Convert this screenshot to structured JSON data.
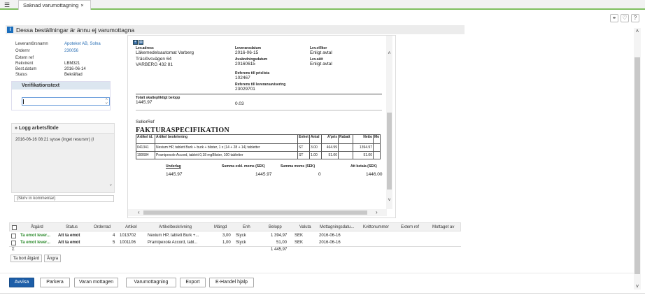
{
  "tab": {
    "title": "Saknad varumottagning",
    "close": "×"
  },
  "notice": "Dessa beställningar är ännu ej varumottagna",
  "info_fields": [
    {
      "label": "Leverantörsnamn",
      "value": "Apoteket AB, Solna",
      "link": true
    },
    {
      "label": "Ordernr",
      "value": "230056",
      "link": true
    },
    {
      "label": "Extern ref",
      "value": ""
    },
    {
      "label": "Rekvirent",
      "value": "LBM321"
    },
    {
      "label": "Best.datum",
      "value": "2016-06-14"
    },
    {
      "label": "Status",
      "value": "Bekräftad"
    }
  ],
  "verification": {
    "title": "Verifikationstext",
    "value": ""
  },
  "log": {
    "title": "Logg arbetsflöde",
    "entry": "2016-06-16 08:21 sysse  (inget resursnr) (I"
  },
  "comment_placeholder": "(Skriv in kommentar)",
  "doc": {
    "lev_adress_label": "Lev.adress",
    "lev_adress": [
      "Läkemedelsautomat Varberg",
      "Träslövsvägen 64",
      "VARBERG 432 81"
    ],
    "leveransdatum_label": "Leveransdatum",
    "leveransdatum": "2016-06-15",
    "avsandningsdatum_label": "Avsändningsdatum",
    "avsandningsdatum": "20160615",
    "ref_prislista_label": "Referens till prislista",
    "ref_prislista": "102467",
    "ref_leveransavisering_label": "Referens till leveransavisering",
    "ref_leveransavisering": "23029701",
    "levvillkor_label": "Lev.villkor",
    "levvillkor": "Enligt avtal",
    "levsatt_label": "Lev.sätt",
    "levsatt": "Enligt avtal",
    "totalt_label": "Totalt skattepliktigt belopp",
    "totalt": "1445.97",
    "moms_value": "0.03",
    "sellerref": "SellerRef",
    "fakt_title": "FAKTURASPECIFIKATION",
    "table_headers": [
      "Artikel id.",
      "Artikel beskrivning",
      "Enhet",
      "Antal",
      "A'pris",
      "Rabatt",
      "Netto",
      "Mo"
    ],
    "table_rows": [
      [
        "041341",
        "Nexium HP, tablett Burk + burk + blister, 1 x (14 + 28 + 14) tabletter",
        "ST",
        "3.00",
        "464.99",
        "",
        "1394.97",
        ""
      ],
      [
        "190684",
        "Pramipexole Accord, tablett 0,18 mgBlister, 100 tabletter",
        "ST",
        "1.00",
        "51.00",
        "",
        "51.00",
        ""
      ]
    ],
    "summary_labels": [
      "Underlag",
      "Summa exkl. moms (SEK)",
      "Summa moms (SEK)",
      "Att betala (SEK)"
    ],
    "summary_values": [
      "1445.97",
      "1445.97",
      "0",
      "1446.00"
    ]
  },
  "grid": {
    "headers": [
      "Åtgärd",
      "Status",
      "Orderrad",
      "Artikel",
      "Artikelbeskrivning",
      "Mängd",
      "Enh",
      "Belopp",
      "Valuta",
      "Mottagningsdatu...",
      "Kvittonummer",
      "Extern ref",
      "Mottaget av"
    ],
    "rows": [
      {
        "atgard": "Ta emot lever...",
        "status": "Att ta emot",
        "orderrad": "4",
        "artikel": "1013702",
        "beskrivning": "Nexium HP, tablett Burk +...",
        "mangd": "3,00",
        "enh": "Styck",
        "belopp": "1 394,97",
        "valuta": "SEK",
        "datum": "2016-06-16"
      },
      {
        "atgard": "Ta emot lever...",
        "status": "Att ta emot",
        "orderrad": "5",
        "artikel": "1001106",
        "beskrivning": "Pramipexole Accord, tabl...",
        "mangd": "1,00",
        "enh": "Styck",
        "belopp": "51,00",
        "valuta": "SEK",
        "datum": "2016-06-16"
      }
    ],
    "sum_symbol": "Σ",
    "sum_value": "1 445,97",
    "btn_remove": "Ta bort åtgärd",
    "btn_undo": "Ångra"
  },
  "footer_buttons": [
    "Avvisa",
    "Parkera",
    "Varan mottagen",
    "Varumottagning",
    "Export",
    "E-Handel hjälp"
  ],
  "colors": {
    "primary": "#1d5ea8",
    "accent_green": "#7fbf5f",
    "link": "#2a6fb5",
    "status_green": "#2c8a2c"
  }
}
